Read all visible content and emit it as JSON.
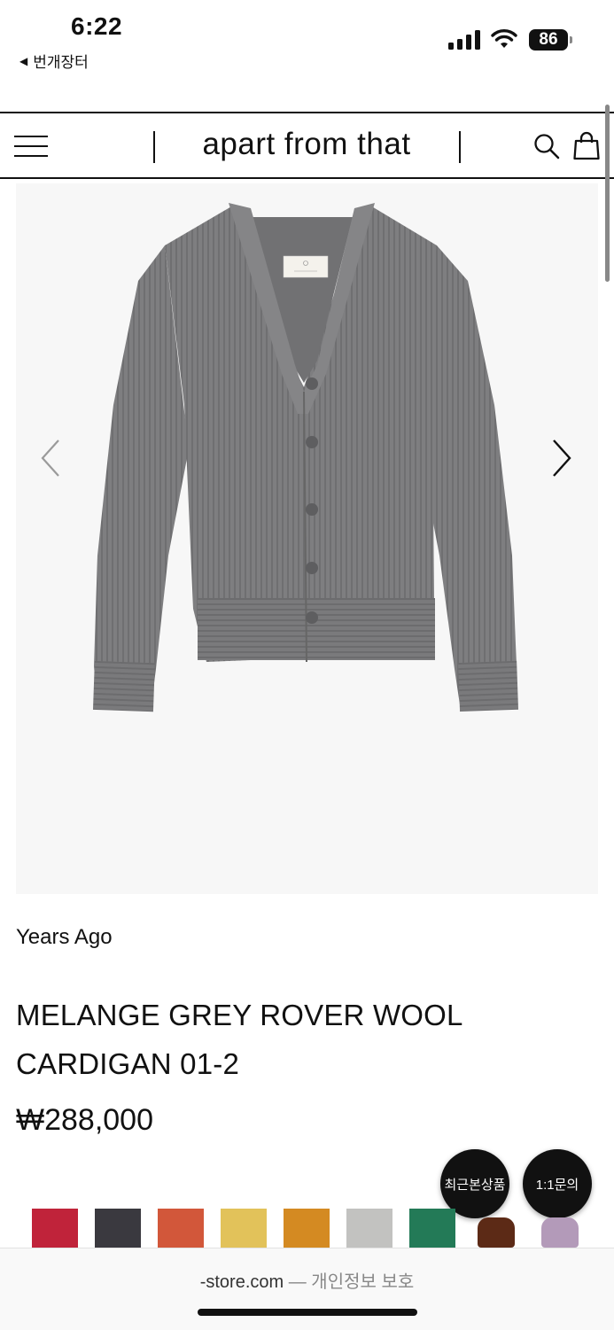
{
  "status_bar": {
    "time": "6:22",
    "back_app": "번개장터",
    "battery": "86"
  },
  "header": {
    "brand": "apart from that",
    "icons": [
      "menu-icon",
      "search-icon",
      "shopping-bag-icon"
    ]
  },
  "product": {
    "image_alt_label": "Years Ago",
    "brand": "Years Ago",
    "title_line1": "MELANGE GREY ROVER WOOL",
    "title_line2": "CARDIGAN 01-2",
    "price": "₩288,000"
  },
  "floating": {
    "recent": "최근본상품",
    "inquiry": "1:1문의"
  },
  "swatches": [
    {
      "name": "red",
      "color": "#c0233a"
    },
    {
      "name": "charcoal",
      "color": "#3a393f"
    },
    {
      "name": "orange",
      "color": "#d2573a"
    },
    {
      "name": "yellow",
      "color": "#e2c25a"
    },
    {
      "name": "mustard",
      "color": "#d48a22"
    },
    {
      "name": "light-grey",
      "color": "#c2c2c0"
    },
    {
      "name": "green",
      "color": "#237a57"
    },
    {
      "name": "brown",
      "color": "#5c2a16"
    },
    {
      "name": "lilac",
      "color": "#b39ab9"
    }
  ],
  "browser": {
    "url": "-store.com",
    "suffix": "— 개인정보 보호"
  },
  "colors": {
    "product_bg": "#f7f7f7",
    "sweater": "#7e7e80"
  }
}
